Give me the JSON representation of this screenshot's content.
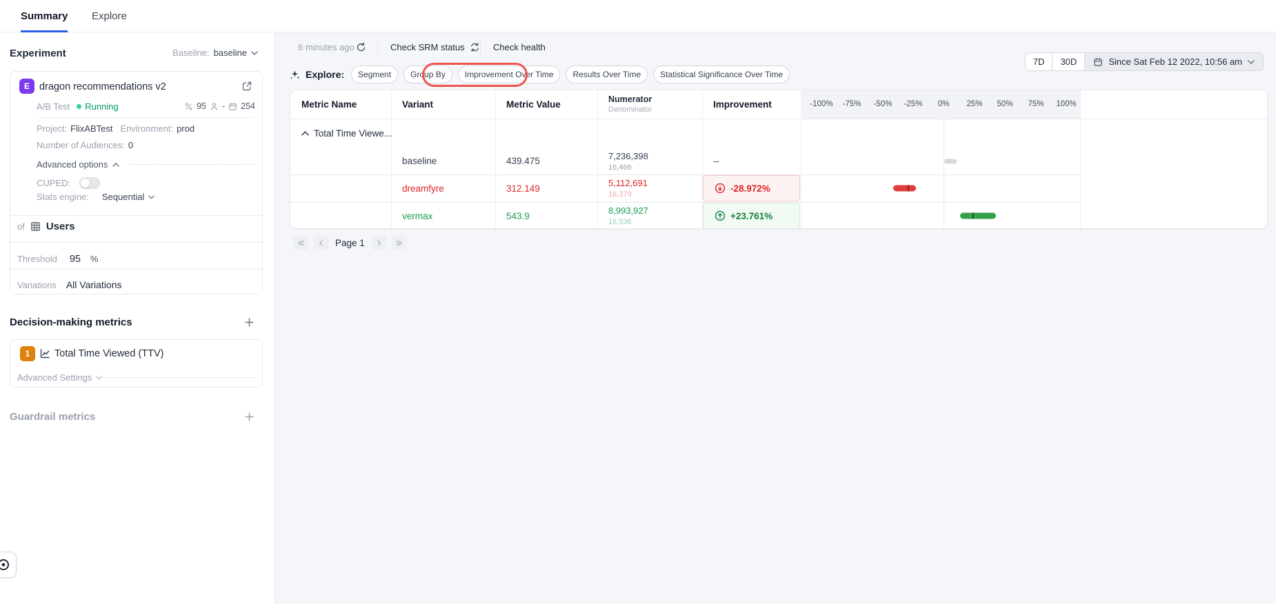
{
  "tabs": {
    "summary": "Summary",
    "explore": "Explore"
  },
  "sidebar": {
    "section_title": "Experiment",
    "baseline_label": "Baseline:",
    "baseline_value": "baseline",
    "experiment": {
      "badge": "E",
      "name": "dragon recommendations v2",
      "type": "A/B Test",
      "status": "Running",
      "allocation": "95",
      "users_stat": "-",
      "days_stat": "254",
      "project_label": "Project:",
      "project": "FlixABTest",
      "environment_label": "Environment:",
      "environment": "prod",
      "audiences_label": "Number of Audiences:",
      "audiences": "0",
      "advanced_options_label": "Advanced options",
      "cuped_label": "CUPED:",
      "stats_engine_label": "Stats engine:",
      "stats_engine_value": "Sequential",
      "of_label": "of",
      "unit_type": "Users",
      "threshold_label": "Threshold",
      "threshold_value": "95",
      "threshold_unit": "%",
      "variations_label": "Variations",
      "variations_value": "All Variations"
    },
    "decision_metrics_title": "Decision-making metrics",
    "metric": {
      "index": "1",
      "name": "Total Time Viewed (TTV)",
      "advanced_settings_label": "Advanced Settings"
    },
    "guardrail_title": "Guardrail metrics"
  },
  "toolbar": {
    "last_refresh": "6 minutes ago",
    "check_srm": "Check SRM status",
    "check_health": "Check health"
  },
  "explore_bar": {
    "label": "Explore:",
    "buttons": [
      "Segment",
      "Group By",
      "Improvement Over Time",
      "Results Over Time",
      "Statistical Significance Over Time"
    ],
    "highlighted_button": "Improvement Over Time"
  },
  "date_controls": {
    "seven_day": "7D",
    "thirty_day": "30D",
    "since": "Since Sat Feb 12 2022, 10:56 am"
  },
  "results_table": {
    "columns": [
      "Metric Name",
      "Variant",
      "Metric Value",
      "Numerator",
      "Improvement"
    ],
    "denominator_sublabel": "Denominator",
    "axis_ticks": [
      "-100%",
      "-75%",
      "-50%",
      "-25%",
      "0%",
      "25%",
      "50%",
      "75%",
      "100%"
    ],
    "metric_group": "Total Time Viewe...",
    "rows": [
      {
        "variant": "baseline",
        "metric_value": "439.475",
        "numerator": "7,236,398",
        "denominator": "16,466",
        "improvement": "--",
        "sentiment": "neutral",
        "ci_pct": [
          0.3,
          10.7
        ],
        "center_pct": null
      },
      {
        "variant": "dreamfyre",
        "metric_value": "312.149",
        "numerator": "5,112,691",
        "denominator": "16,379",
        "improvement": "-28.972%",
        "sentiment": "negative",
        "ci_pct": [
          -41.4,
          -22.6
        ],
        "center_pct": -28.972
      },
      {
        "variant": "vermax",
        "metric_value": "543.9",
        "numerator": "8,993,927",
        "denominator": "16,536",
        "improvement": "+23.761%",
        "sentiment": "positive",
        "ci_pct": [
          13.0,
          42.5
        ],
        "center_pct": 23.761
      }
    ]
  },
  "pagination": {
    "label": "Page 1"
  },
  "colors": {
    "accent_blue": "#2b5ce6",
    "badge_purple": "#7c3aed",
    "badge_orange": "#e0810f",
    "running_green": "#059669",
    "negative_red": "#dc2626",
    "positive_green": "#15803d",
    "bar_red": "#e23b3b",
    "bar_green": "#34a04a",
    "bar_gray": "#d7d9dd",
    "annotation_red": "#ef5350"
  }
}
